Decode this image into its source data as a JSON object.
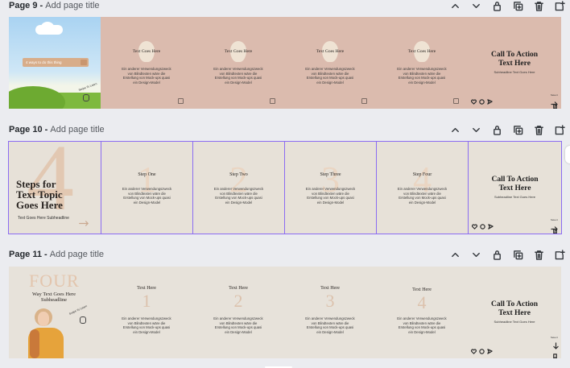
{
  "pages": [
    {
      "number_label": "Page 9",
      "separator": " - ",
      "title_placeholder": "Add page title",
      "cover": {
        "pill_text": "4 ways to do this thing",
        "learn_more": "Swipe To Learn"
      },
      "slides": [
        {
          "title": "Text Goes Here",
          "body": "Ein anderer Verwendungszweck\nvon Blindtexten wäre die\nErstellung von Mock-ups quasi\nein Design-Model"
        },
        {
          "title": "Text Goes Here",
          "body": "Ein anderer Verwendungszweck\nvon Blindtexten wäre die\nErstellung von Mock-ups quasi\nein Design-Model"
        },
        {
          "title": "Text Goes Here",
          "body": "Ein anderer Verwendungszweck\nvon Blindtexten wäre die\nErstellung von Mock-ups quasi\nein Design-Model"
        },
        {
          "title": "Text Goes Here",
          "body": "Ein anderer Verwendungszweck\nvon Blindtexten wäre die\nErstellung von Mock-ups quasi\nein Design-Model"
        }
      ],
      "cta": {
        "title": "Call To Action\nText Here",
        "subtitle": "Subheadline Text Goes Here",
        "save_label": "Save it"
      }
    },
    {
      "number_label": "Page 10",
      "separator": " - ",
      "title_placeholder": "Add page title",
      "cover": {
        "big_number": "4",
        "headline": "Steps for\nText Topic\nGoes Here",
        "subheadline": "Text Goes Here Subheadline"
      },
      "slides": [
        {
          "title": "Step One",
          "body": "Ein anderer Verwendungszweck\nvon Blindtexten wäre die\nErstellung von Mock-ups quasi\nein Design-Model",
          "number": "1"
        },
        {
          "title": "Step Two",
          "body": "Ein anderer Verwendungszweck\nvon Blindtexten wäre die\nErstellung von Mock-ups quasi\nein Design-Model",
          "number": "2"
        },
        {
          "title": "Step Three",
          "body": "Ein anderer Verwendungszweck\nvon Blindtexten wäre die\nErstellung von Mock-ups quasi\nein Design-Model",
          "number": "3"
        },
        {
          "title": "Step Four",
          "body": "Ein anderer Verwendungszweck\nvon Blindtexten wäre die\nErstellung von Mock-ups quasi\nein Design-Model",
          "number": "4"
        }
      ],
      "cta": {
        "title": "Call To Action\nText Here",
        "subtitle": "Subheadline Text Goes Here",
        "save_label": "Save it"
      }
    },
    {
      "number_label": "Page 11",
      "separator": " - ",
      "title_placeholder": "Add page title",
      "cover": {
        "big_word": "FOUR",
        "headline": "Way Text Goes Here\nSubheadline",
        "learn_more": "Swipe To Learn"
      },
      "slides": [
        {
          "title": "Text Here",
          "number": "1",
          "body": "Ein anderer Verwendungszweck\nvon Blindtexten wäre die\nErstellung von Mock-ups quasi\nein Design-Model"
        },
        {
          "title": "Text Here",
          "number": "2",
          "body": "Ein anderer Verwendungszweck\nvon Blindtexten wäre die\nErstellung von Mock-ups quasi\nein Design-Model"
        },
        {
          "title": "Text Here",
          "number": "3",
          "body": "Ein anderer Verwendungszweck\nvon Blindtexten wäre die\nErstellung von Mock-ups quasi\nein Design-Model"
        },
        {
          "title": "Text Here",
          "number": "4",
          "body": "Ein anderer Verwendungszweck\nvon Blindtexten wäre die\nErstellung von Mock-ups quasi\nein Design-Model"
        }
      ],
      "cta": {
        "title": "Call To Action\nText Here",
        "subtitle": "Subheadline Text Goes Here",
        "save_label": "Save it"
      }
    }
  ],
  "toolbar_icons": [
    "chevron-up-icon",
    "chevron-down-icon",
    "lock-icon",
    "duplicate-icon",
    "trash-icon",
    "add-page-icon"
  ],
  "colors": {
    "canvas_bg": "#ebecf0",
    "page9_slide_bg": "#dbbbae",
    "page10_slide_bg": "#e7e1d8",
    "page11_slide_bg": "#e7e2da",
    "selection": "#8b6cf2",
    "accent_number": "#d9b89c"
  }
}
